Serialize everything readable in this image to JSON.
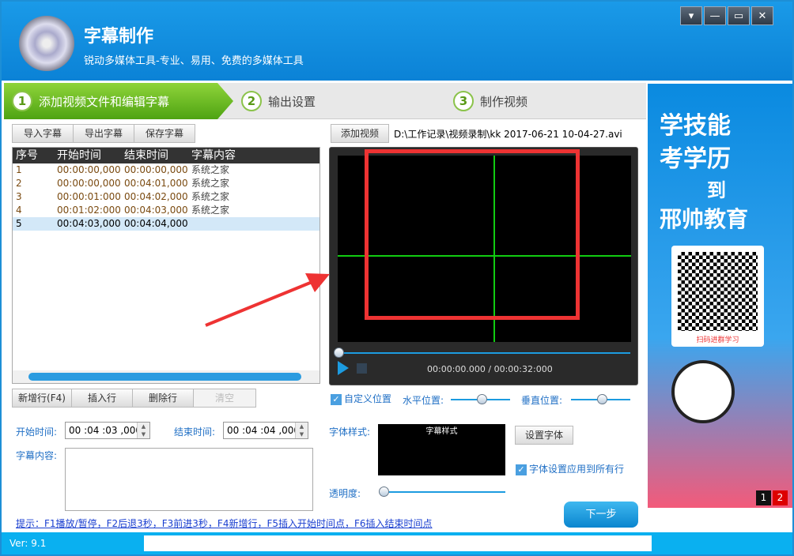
{
  "app": {
    "title": "字幕制作",
    "subtitle": "锐动多媒体工具-专业、易用、免费的多媒体工具",
    "window_buttons": [
      "▾",
      "—",
      "▭",
      "✕"
    ]
  },
  "steps": [
    {
      "num": "1",
      "label": "添加视频文件和编辑字幕"
    },
    {
      "num": "2",
      "label": "输出设置"
    },
    {
      "num": "3",
      "label": "制作视频"
    }
  ],
  "toolbar": {
    "import": "导入字幕",
    "export": "导出字幕",
    "save": "保存字幕"
  },
  "table": {
    "headers": [
      "序号",
      "开始时间",
      "结束时间",
      "字幕内容"
    ],
    "rows": [
      [
        "1",
        "00:00:00,000",
        "00:00:00,000",
        "系统之家"
      ],
      [
        "2",
        "00:00:00,000",
        "00:04:01,000",
        "系统之家"
      ],
      [
        "3",
        "00:00:01:000",
        "00:04:02,000",
        "系统之家"
      ],
      [
        "4",
        "00:01:02:000",
        "00:04:03,000",
        "系统之家"
      ],
      [
        "5",
        "00:04:03,000",
        "00:04:04,000",
        ""
      ]
    ],
    "selected_row": 5
  },
  "row_buttons": {
    "new": "新增行(F4)",
    "insert": "插入行",
    "delete": "删除行",
    "clear": "清空"
  },
  "editor": {
    "start_label": "开始时间:",
    "start_value": "00 :04 :03 ,000",
    "end_label": "结束时间:",
    "end_value": "00 :04 :04 ,000",
    "content_label": "字幕内容:",
    "content_value": ""
  },
  "hint": "提示：F1播放/暂停，F2后退3秒，F3前进3秒，F4新增行，F5插入开始时间点，F6插入结束时间点",
  "video": {
    "add_button": "添加视频",
    "path": "D:\\工作记录\\视频录制\\kk 2017-06-21 10-04-27.avi",
    "time": "00:00:00.000 / 00:00:32:000",
    "progress": 0
  },
  "position": {
    "custom_label": "自定义位置",
    "custom_checked": true,
    "h_label": "水平位置:",
    "h_value": 50,
    "v_label": "垂直位置:",
    "v_value": 50
  },
  "font": {
    "label": "字体样式:",
    "preview": "字幕样式",
    "set_button": "设置字体",
    "apply_all_label": "字体设置应用到所有行",
    "apply_all_checked": true
  },
  "opacity": {
    "label": "透明度:",
    "value": 0
  },
  "next_button": "下一步",
  "ad": {
    "line1": "学技能",
    "line2": "考学历",
    "line3": "到",
    "line4": "邢帅教育",
    "qr_caption": "扫码进群学习",
    "pages": [
      "1",
      "2"
    ]
  },
  "status": {
    "version": "Ver: 9.1"
  },
  "colors": {
    "accent": "#0b82d6",
    "step_active": "#4ea312",
    "annotation": "#ee3333"
  }
}
